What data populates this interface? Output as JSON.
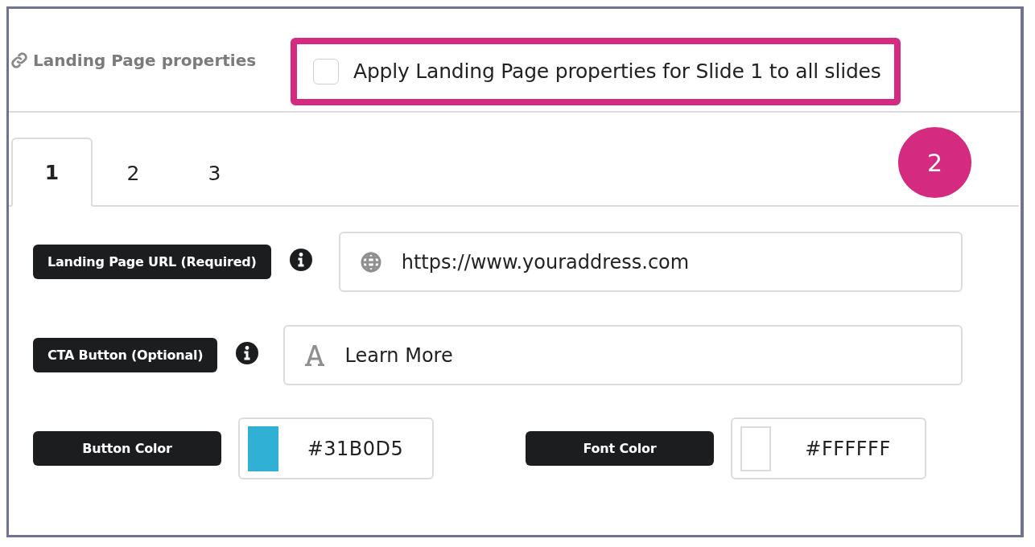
{
  "header": {
    "title": "Landing Page properties",
    "apply_all": {
      "label": "Apply Landing Page properties for Slide 1 to all slides",
      "checked": false,
      "highlighted": true
    }
  },
  "step_badge": "2",
  "tabs": [
    {
      "label": "1",
      "selected": true
    },
    {
      "label": "2",
      "selected": false
    },
    {
      "label": "3",
      "selected": false
    }
  ],
  "fields": [
    {
      "kind": "url",
      "label": "Landing Page URL (Required)",
      "info": true,
      "value": "https://www.youraddress.com"
    },
    {
      "kind": "text",
      "label": "CTA Button (Optional)",
      "info": true,
      "value": "Learn More"
    }
  ],
  "colors": [
    {
      "label": "Button Color",
      "value": "#31B0D5",
      "color": "#31b0d5"
    },
    {
      "label": "Font Color",
      "value": "#FFFFFF",
      "color": "#ffffff"
    }
  ]
}
